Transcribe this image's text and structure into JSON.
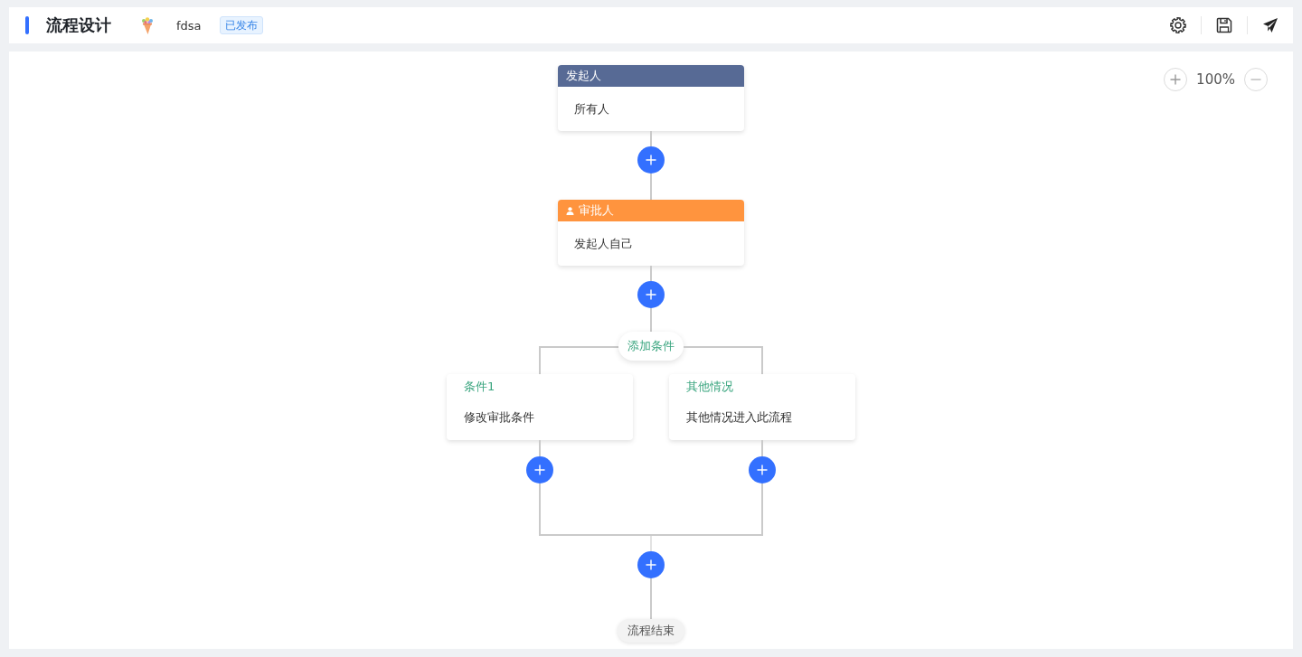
{
  "header": {
    "title": "流程设计",
    "name": "fdsa",
    "status": "已发布"
  },
  "zoom": {
    "level_text": "100%"
  },
  "flow": [
    {
      "kind": "start",
      "title": "发起人",
      "content": "所有人"
    },
    {
      "kind": "approver",
      "title": "审批人",
      "content": "发起人自己"
    },
    {
      "kind": "condition",
      "add_label": "添加条件",
      "branches": [
        {
          "title": "条件1",
          "content": "修改审批条件"
        },
        {
          "title": "其他情况",
          "content": "其他情况进入此流程"
        }
      ]
    },
    {
      "kind": "end",
      "label": "流程结束"
    }
  ]
}
